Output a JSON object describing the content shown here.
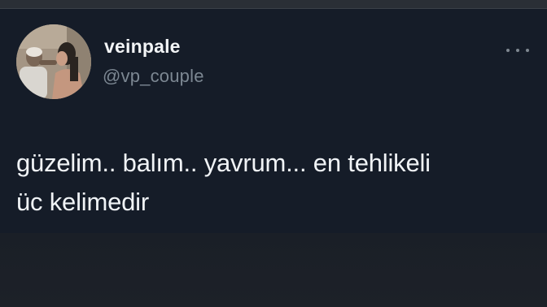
{
  "tweet": {
    "author": {
      "display_name": "veinpale",
      "handle": "@vp_couple",
      "avatar_icon": "profile-photo"
    },
    "more_icon": "more-horizontal-icon",
    "text_lines": [
      "güzelim.. balım.. yavrum... en tehlikeli",
      "üc kelimedir"
    ]
  },
  "colors": {
    "background": "#151c28",
    "name": "#f2f4f6",
    "handle": "#7c8792",
    "text": "#f0f3f6"
  }
}
